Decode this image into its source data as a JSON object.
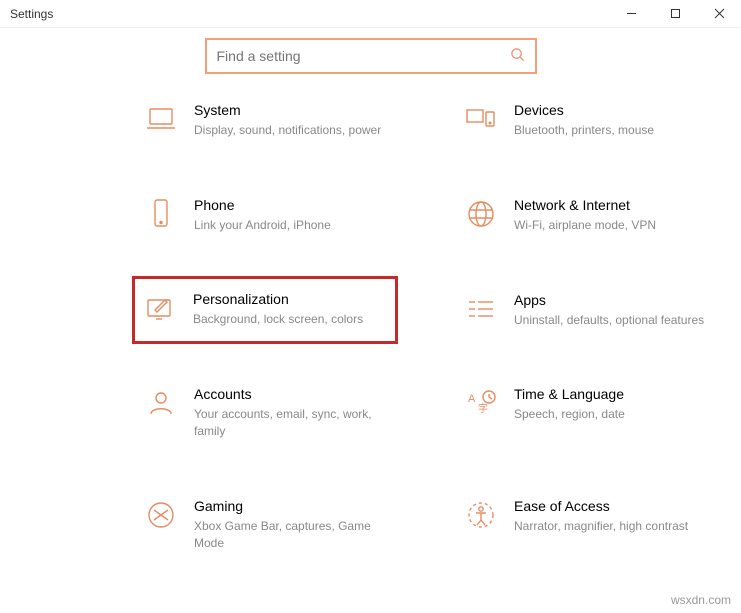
{
  "window": {
    "title": "Settings"
  },
  "search": {
    "placeholder": "Find a setting"
  },
  "items": [
    {
      "icon": "laptop-icon",
      "title": "System",
      "sub": "Display, sound, notifications, power"
    },
    {
      "icon": "devices-icon",
      "title": "Devices",
      "sub": "Bluetooth, printers, mouse"
    },
    {
      "icon": "phone-icon",
      "title": "Phone",
      "sub": "Link your Android, iPhone"
    },
    {
      "icon": "globe-icon",
      "title": "Network & Internet",
      "sub": "Wi-Fi, airplane mode, VPN"
    },
    {
      "icon": "personalize-icon",
      "title": "Personalization",
      "sub": "Background, lock screen, colors",
      "highlight": true
    },
    {
      "icon": "apps-icon",
      "title": "Apps",
      "sub": "Uninstall, defaults, optional features"
    },
    {
      "icon": "accounts-icon",
      "title": "Accounts",
      "sub": "Your accounts, email, sync, work, family"
    },
    {
      "icon": "time-lang-icon",
      "title": "Time & Language",
      "sub": "Speech, region, date"
    },
    {
      "icon": "gaming-icon",
      "title": "Gaming",
      "sub": "Xbox Game Bar, captures, Game Mode"
    },
    {
      "icon": "ease-access-icon",
      "title": "Ease of Access",
      "sub": "Narrator, magnifier, high contrast"
    }
  ],
  "watermark": "wsxdn.com"
}
